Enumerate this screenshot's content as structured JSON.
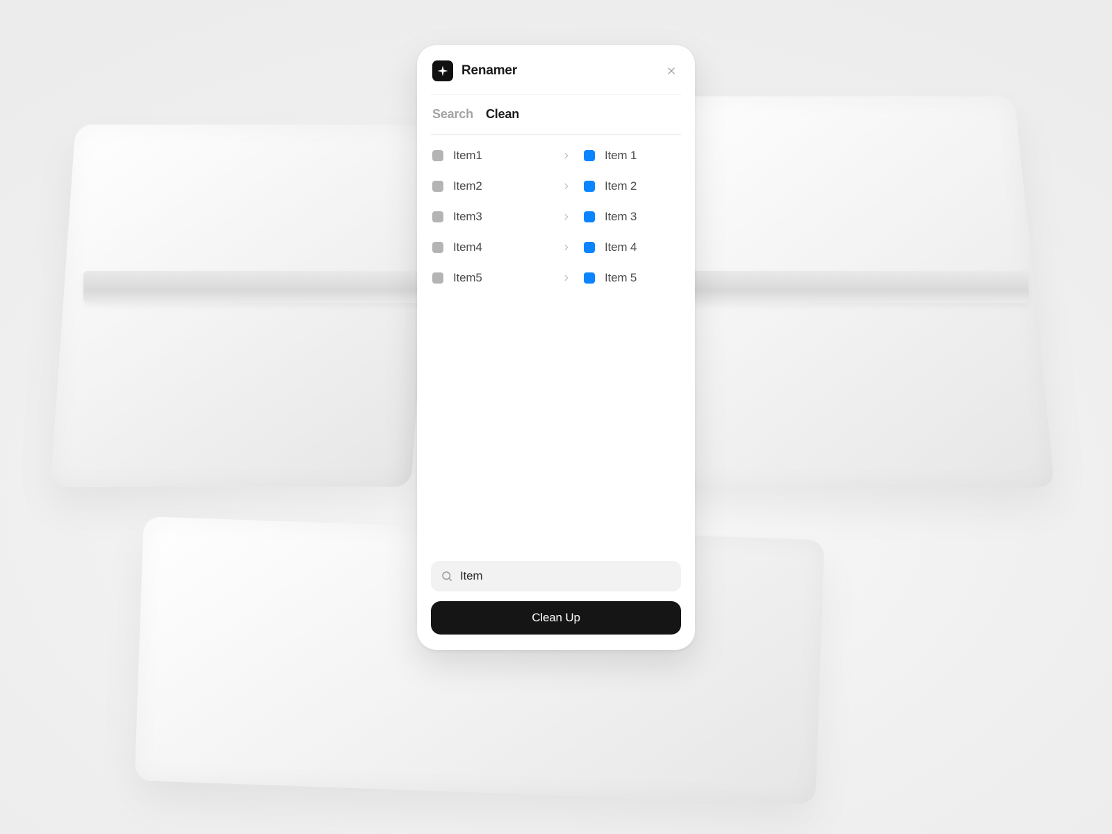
{
  "header": {
    "title": "Renamer",
    "close_aria": "Close"
  },
  "tabs": {
    "search": "Search",
    "clean": "Clean",
    "active": "clean"
  },
  "colors": {
    "original": "#b4b4b4",
    "renamed": "#0a84ff",
    "accent_black": "#151515"
  },
  "items": [
    {
      "from": "Item1",
      "to": "Item 1"
    },
    {
      "from": "Item2",
      "to": "Item 2"
    },
    {
      "from": "Item3",
      "to": "Item 3"
    },
    {
      "from": "Item4",
      "to": "Item 4"
    },
    {
      "from": "Item5",
      "to": "Item 5"
    }
  ],
  "search": {
    "value": "Item",
    "placeholder": "Item"
  },
  "actions": {
    "primary": "Clean Up"
  }
}
